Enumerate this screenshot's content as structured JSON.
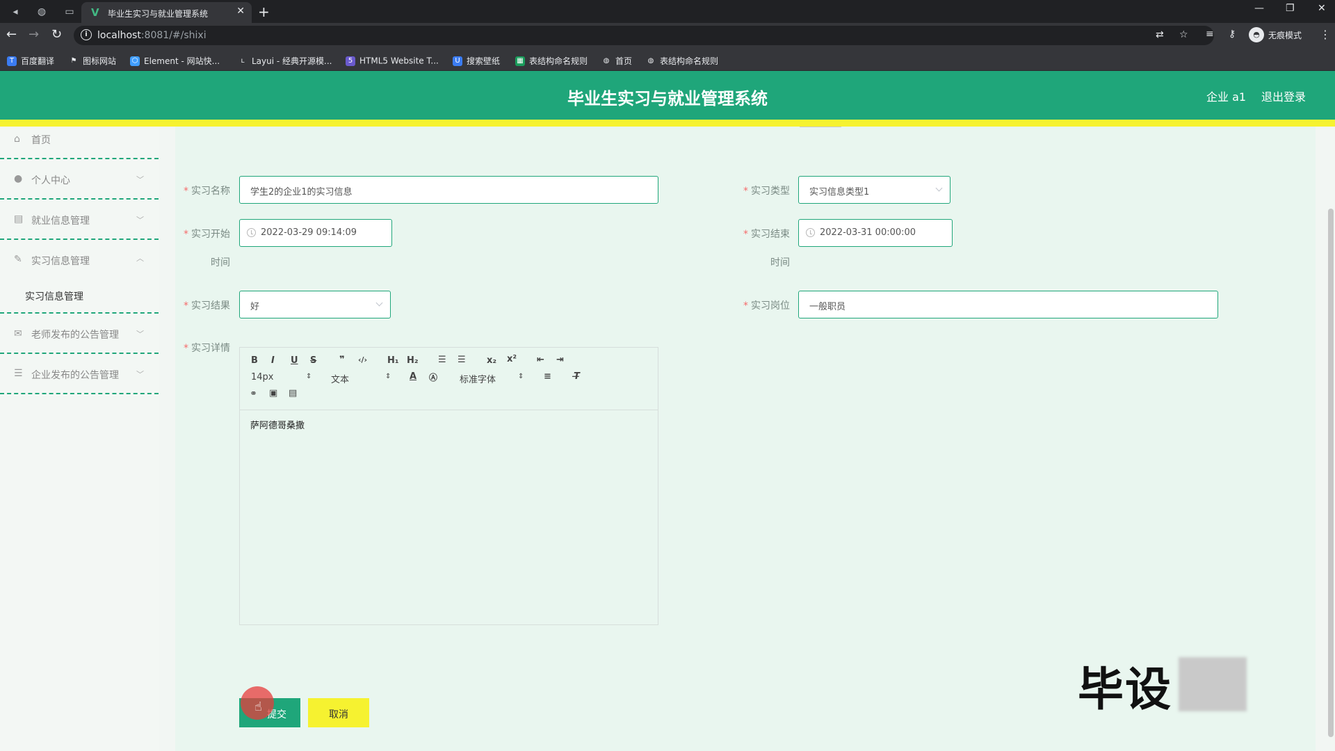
{
  "browser": {
    "tab_title": "毕业生实习与就业管理系统",
    "tab_favicon": "V",
    "url_host": "localhost",
    "url_path": ":8081/#/shixi",
    "incognito_label": "无痕模式",
    "bookmarks": [
      {
        "label": "百度翻译",
        "icon": "translate-icon",
        "color": "#3b7cf2"
      },
      {
        "label": "图标网站",
        "icon": "flag-icon",
        "color": "#35363a"
      },
      {
        "label": "Element - 网站快...",
        "icon": "element-icon",
        "color": "#409eff"
      },
      {
        "label": "Layui - 经典开源模...",
        "icon": "layui-icon",
        "color": "#35363a"
      },
      {
        "label": "HTML5 Website T...",
        "icon": "html5-icon",
        "color": "#6a5acd"
      },
      {
        "label": "搜索壁纸",
        "icon": "wallpaper-icon",
        "color": "#3b7cf2"
      },
      {
        "label": "表结构命名规则",
        "icon": "sheet-icon",
        "color": "#1a9c5b"
      },
      {
        "label": "首页",
        "icon": "globe-icon",
        "color": "#35363a"
      },
      {
        "label": "表结构命名规则",
        "icon": "globe-icon",
        "color": "#35363a"
      }
    ]
  },
  "header": {
    "title": "毕业生实习与就业管理系统",
    "user": "企业 a1",
    "logout": "退出登录"
  },
  "sidebar": {
    "items": [
      {
        "label": "首页",
        "icon": "home-icon"
      },
      {
        "label": "个人中心",
        "icon": "user-icon"
      },
      {
        "label": "就业信息管理",
        "icon": "clipboard-icon"
      },
      {
        "label": "实习信息管理",
        "icon": "edit-icon"
      },
      {
        "label": "老师发布的公告管理",
        "icon": "mail-icon"
      },
      {
        "label": "企业发布的公告管理",
        "icon": "sliders-icon"
      }
    ],
    "submenu_label": "实习信息管理"
  },
  "form": {
    "name_label": "实习名称",
    "name_value": "学生2的企业1的实习信息",
    "type_label": "实习类型",
    "type_value": "实习信息类型1",
    "start_label": "实习开始",
    "start_label_sub": "时间",
    "start_value": "2022-03-29 09:14:09",
    "end_label": "实习结束",
    "end_label_sub": "时间",
    "end_value": "2022-03-31 00:00:00",
    "result_label": "实习结果",
    "result_value": "好",
    "position_label": "实习岗位",
    "position_value": "一般职员",
    "detail_label": "实习详情"
  },
  "editor": {
    "font_size": "14px",
    "text_style": "文本",
    "font_family": "标准字体",
    "content": "萨阿德哥桑撒"
  },
  "buttons": {
    "submit": "提交",
    "cancel": "取消"
  },
  "watermark": "毕设"
}
